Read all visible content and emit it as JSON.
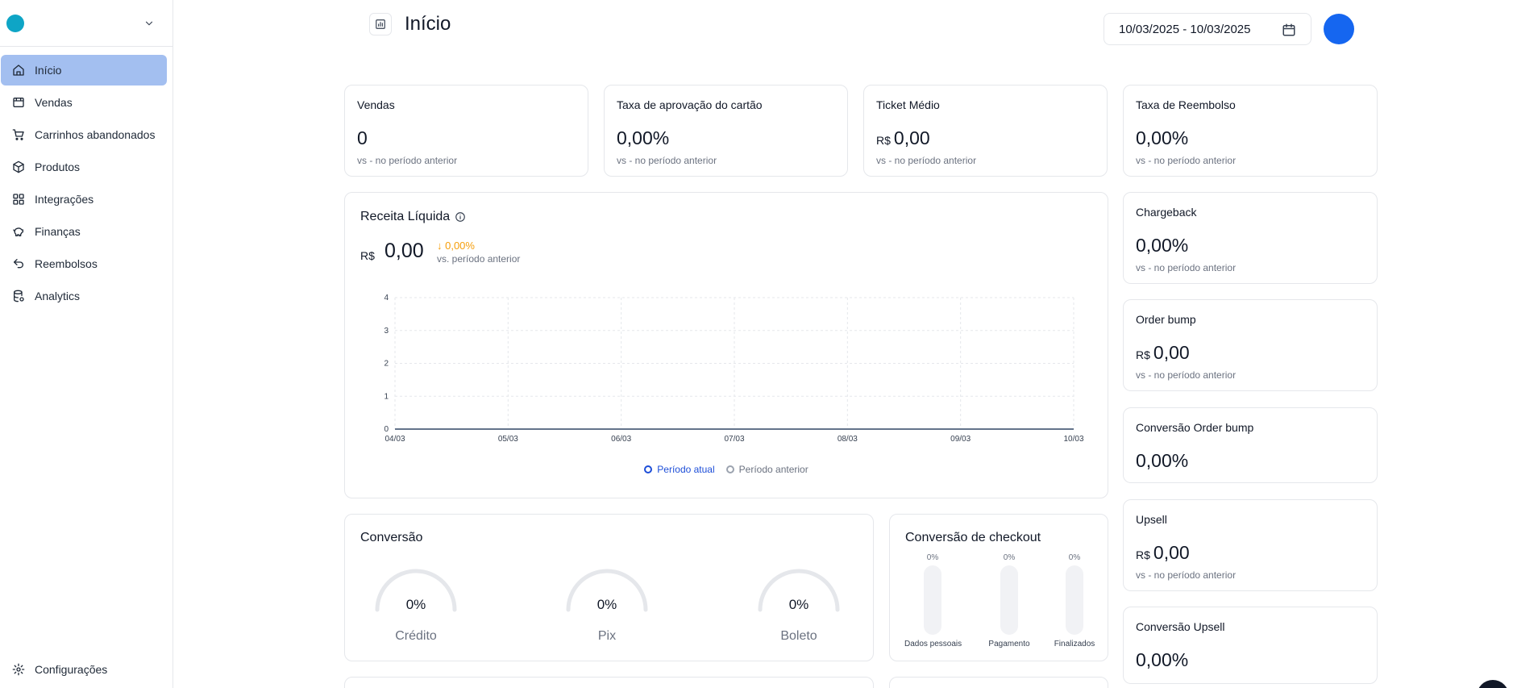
{
  "sidebar": {
    "items": [
      {
        "label": "Início",
        "icon": "home-icon",
        "active": true
      },
      {
        "label": "Vendas",
        "icon": "store-icon"
      },
      {
        "label": "Carrinhos abandonados",
        "icon": "cart-icon"
      },
      {
        "label": "Produtos",
        "icon": "box-icon"
      },
      {
        "label": "Integrações",
        "icon": "grid-icon"
      },
      {
        "label": "Finanças",
        "icon": "piggy-bank-icon"
      },
      {
        "label": "Reembolsos",
        "icon": "undo-icon"
      },
      {
        "label": "Analytics",
        "icon": "database-icon"
      }
    ],
    "settings_label": "Configurações"
  },
  "header": {
    "title": "Início",
    "date_range": "10/03/2025 - 10/03/2025"
  },
  "metrics": {
    "vendas": {
      "title": "Vendas",
      "value": "0",
      "sub": "vs - no período anterior"
    },
    "aprovacao": {
      "title": "Taxa de aprovação do cartão",
      "value": "0,00%",
      "sub": "vs - no período anterior"
    },
    "ticket": {
      "title": "Ticket Médio",
      "currency": "R$",
      "value": "0,00",
      "sub": "vs - no período anterior"
    },
    "reembolso": {
      "title": "Taxa de Reembolso",
      "value": "0,00%",
      "sub": "vs - no período anterior"
    },
    "chargeback": {
      "title": "Chargeback",
      "value": "0,00%",
      "sub": "vs - no período anterior"
    },
    "orderbump": {
      "title": "Order bump",
      "currency": "R$",
      "value": "0,00",
      "sub": "vs - no período anterior"
    },
    "conv_orderbump": {
      "title": "Conversão Order bump",
      "value": "0,00%"
    },
    "upsell": {
      "title": "Upsell",
      "currency": "R$",
      "value": "0,00",
      "sub": "vs - no período anterior"
    },
    "conv_upsell": {
      "title": "Conversão Upsell",
      "value": "0,00%"
    }
  },
  "revenue": {
    "title": "Receita Líquida",
    "currency": "R$",
    "value": "0,00",
    "delta": "↓ 0,00%",
    "vs_label": "vs. período anterior",
    "legend_current": "Período atual",
    "legend_previous": "Período anterior",
    "colors": {
      "current": "#1d4ed8",
      "previous": "#9ca3af",
      "delta": "#f59e0b"
    }
  },
  "chart_data": {
    "type": "line",
    "x": [
      "04/03",
      "05/03",
      "06/03",
      "07/03",
      "08/03",
      "09/03",
      "10/03"
    ],
    "ylim": [
      0,
      4
    ],
    "yticks": [
      "0",
      "1",
      "2",
      "3",
      "4"
    ],
    "grid": true,
    "legend": "bottom",
    "series": [
      {
        "name": "Período atual",
        "values": [
          0,
          0,
          0,
          0,
          0,
          0,
          0
        ]
      },
      {
        "name": "Período anterior",
        "values": [
          0,
          0,
          0,
          0,
          0,
          0,
          0
        ]
      }
    ]
  },
  "conversion": {
    "title": "Conversão",
    "gauges": [
      {
        "label": "Crédito",
        "value": "0%",
        "fraction": 0
      },
      {
        "label": "Pix",
        "value": "0%",
        "fraction": 0
      },
      {
        "label": "Boleto",
        "value": "0%",
        "fraction": 0
      }
    ]
  },
  "checkout": {
    "title": "Conversão de checkout",
    "steps": [
      {
        "label": "Dados pessoais",
        "value": "0%",
        "fraction": 0
      },
      {
        "label": "Pagamento",
        "value": "0%",
        "fraction": 0
      },
      {
        "label": "Finalizados",
        "value": "0%",
        "fraction": 0
      }
    ]
  }
}
